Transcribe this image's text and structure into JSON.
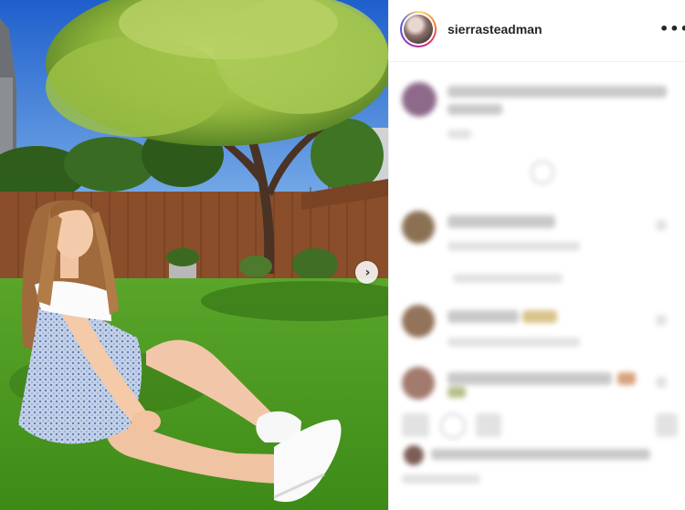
{
  "post": {
    "username": "sierrasteadman",
    "more_label": "•••",
    "carousel_next_label": "›"
  },
  "colors": {
    "sky": "#2b70d6",
    "grass": "#3f8d1c",
    "fence": "#8a4e2b",
    "dress": "#b9c8e2",
    "story_ring": [
      "#feda75",
      "#fa7e1e",
      "#d62976",
      "#962fbf",
      "#4f5bd5"
    ]
  },
  "icons": [
    "chevron-right-icon",
    "more-options-icon"
  ]
}
